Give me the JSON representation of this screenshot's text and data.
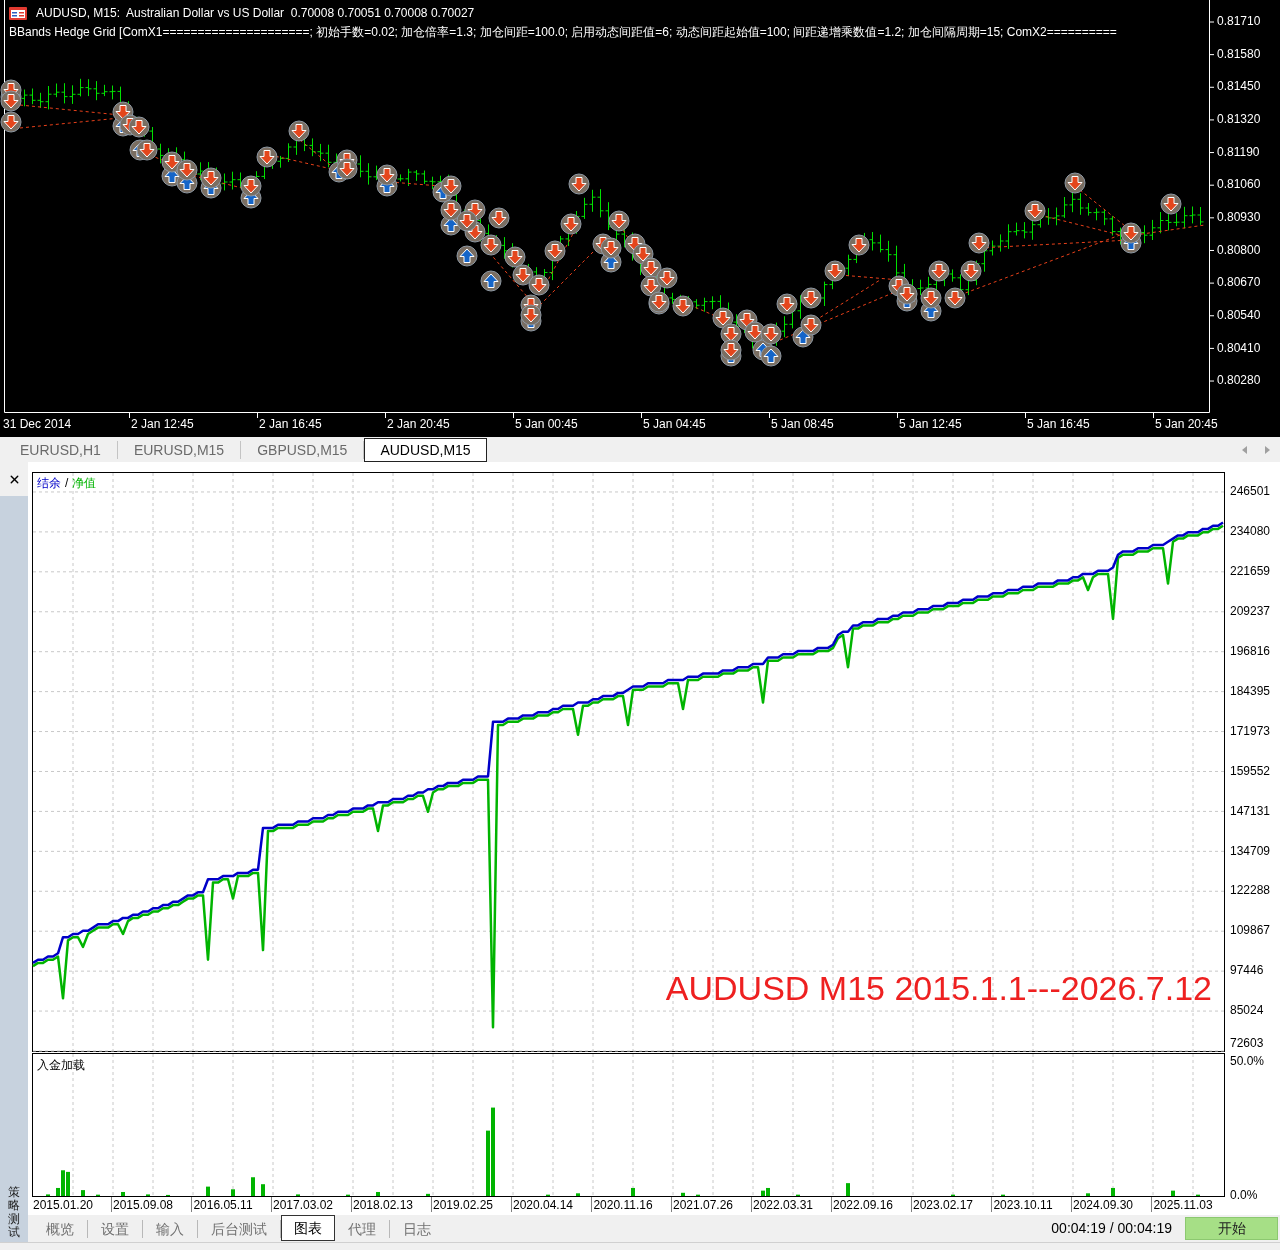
{
  "chart_window": {
    "symbol_line": "AUDUSD, M15:  Australian Dollar vs US Dollar  0.70008 0.70051 0.70008 0.70027",
    "indicator_line": "BBands Hedge Grid [ComX1=====================; 初始手数=0.02; 加仓倍率=1.3; 加仓间距=100.0; 启用动态间距值=6; 动态间距起始值=100; 间距递增乘数值=1.2; 加仓间隔周期=15; ComX2==========",
    "price_labels": [
      "0.81710",
      "0.81580",
      "0.81450",
      "0.81320",
      "0.81190",
      "0.81060",
      "0.80930",
      "0.80800",
      "0.80670",
      "0.80540",
      "0.80410",
      "0.80280"
    ],
    "time_labels": [
      "31 Dec 2014",
      "2 Jan 12:45",
      "2 Jan 16:45",
      "2 Jan 20:45",
      "5 Jan 00:45",
      "5 Jan 04:45",
      "5 Jan 08:45",
      "5 Jan 12:45",
      "5 Jan 16:45",
      "5 Jan 20:45"
    ]
  },
  "chart_tabs": [
    {
      "label": "EURUSD,H1",
      "selected": false
    },
    {
      "label": "EURUSD,M15",
      "selected": false
    },
    {
      "label": "GBPUSD,M15",
      "selected": false
    },
    {
      "label": "AUDUSD,M15",
      "selected": true
    }
  ],
  "tester": {
    "panel_title": "策略测试",
    "equity_chart": {
      "legend_separator": "/",
      "chart_data": {
        "type": "line",
        "grid": true,
        "series": [
          {
            "name": "结余",
            "color": "#0000c8",
            "values": [
              100000,
              101000,
              101000,
              102000,
              102000,
              103000,
              108000,
              108000,
              109000,
              109000,
              110000,
              110000,
              111000,
              112000,
              112000,
              112000,
              113000,
              113000,
              114000,
              114000,
              115000,
              115000,
              116000,
              116000,
              117000,
              117000,
              118000,
              118000,
              119000,
              119000,
              120000,
              121000,
              121000,
              122000,
              122000,
              126000,
              126000,
              126000,
              127000,
              127000,
              127000,
              128000,
              128000,
              128000,
              129000,
              129000,
              142000,
              142000,
              142000,
              143000,
              143000,
              143000,
              143000,
              144000,
              144000,
              144000,
              145000,
              145000,
              145000,
              146000,
              146000,
              147000,
              147000,
              147000,
              148000,
              148000,
              148000,
              149000,
              149000,
              150000,
              150000,
              150000,
              151000,
              151000,
              151000,
              152000,
              152000,
              153000,
              153000,
              154000,
              154000,
              155000,
              155000,
              156000,
              156000,
              156000,
              157000,
              157000,
              157000,
              158000,
              158000,
              158000,
              175000,
              175000,
              175000,
              176000,
              176000,
              176000,
              177000,
              177000,
              177000,
              178000,
              178000,
              178000,
              179000,
              179000,
              180000,
              180000,
              180000,
              181000,
              181000,
              181000,
              182000,
              182000,
              183000,
              183000,
              183000,
              184000,
              184000,
              185000,
              186000,
              186000,
              186000,
              187000,
              187000,
              187000,
              187000,
              188000,
              188000,
              188000,
              188000,
              189000,
              189000,
              189000,
              190000,
              190000,
              190000,
              190000,
              191000,
              191000,
              191000,
              192000,
              192000,
              192000,
              193000,
              193000,
              193000,
              195000,
              195000,
              195000,
              196000,
              196000,
              196000,
              197000,
              197000,
              197000,
              197000,
              198000,
              198000,
              198000,
              199000,
              202000,
              203000,
              203000,
              205000,
              205000,
              206000,
              206000,
              206000,
              207000,
              207000,
              207000,
              208000,
              208000,
              209000,
              209000,
              209000,
              210000,
              210000,
              210000,
              211000,
              211000,
              211000,
              212000,
              212000,
              212000,
              213000,
              213000,
              213000,
              214000,
              214000,
              214000,
              215000,
              215000,
              215000,
              216000,
              216000,
              216000,
              217000,
              217000,
              217000,
              218000,
              218000,
              218000,
              218000,
              219000,
              219000,
              219000,
              220000,
              220000,
              221000,
              221000,
              221000,
              222000,
              222000,
              222000,
              223000,
              227000,
              228000,
              228000,
              228000,
              229000,
              229000,
              229000,
              230000,
              230000,
              230000,
              231000,
              232000,
              233000,
              233000,
              234000,
              234000,
              234000,
              235000,
              235000,
              236000,
              236000,
              237000
            ]
          },
          {
            "name": "净值",
            "color": "#00b400",
            "values": [
              99000,
              100000,
              100000,
              101000,
              101000,
              102000,
              89000,
              107000,
              108000,
              108000,
              105000,
              109000,
              110000,
              111000,
              111000,
              111000,
              112000,
              112000,
              109000,
              113000,
              114000,
              114000,
              115000,
              115000,
              116000,
              116000,
              117000,
              117000,
              118000,
              118000,
              119000,
              120000,
              120000,
              121000,
              121000,
              101000,
              125000,
              125000,
              126000,
              126000,
              120000,
              127000,
              127000,
              127000,
              128000,
              128000,
              104000,
              141000,
              141000,
              142000,
              142000,
              142000,
              142000,
              143000,
              143000,
              143000,
              144000,
              144000,
              144000,
              145000,
              145000,
              146000,
              146000,
              146000,
              147000,
              147000,
              147000,
              148000,
              148000,
              141000,
              149000,
              149000,
              150000,
              150000,
              150000,
              151000,
              151000,
              152000,
              152000,
              147000,
              153000,
              154000,
              154000,
              155000,
              155000,
              155000,
              156000,
              156000,
              156000,
              157000,
              157000,
              157000,
              80000,
              174000,
              174000,
              175000,
              175000,
              175000,
              176000,
              176000,
              176000,
              177000,
              177000,
              177000,
              178000,
              178000,
              179000,
              179000,
              179000,
              171000,
              180000,
              180000,
              181000,
              181000,
              182000,
              182000,
              182000,
              183000,
              183000,
              174000,
              185000,
              185000,
              185000,
              186000,
              186000,
              186000,
              186000,
              187000,
              187000,
              187000,
              179000,
              188000,
              188000,
              188000,
              189000,
              189000,
              189000,
              189000,
              190000,
              190000,
              190000,
              191000,
              191000,
              191000,
              192000,
              192000,
              181000,
              194000,
              194000,
              194000,
              195000,
              195000,
              195000,
              196000,
              196000,
              196000,
              196000,
              197000,
              197000,
              197000,
              198000,
              201000,
              202000,
              192000,
              204000,
              204000,
              205000,
              205000,
              205000,
              206000,
              206000,
              206000,
              207000,
              207000,
              208000,
              208000,
              208000,
              209000,
              209000,
              209000,
              210000,
              210000,
              210000,
              211000,
              211000,
              211000,
              212000,
              212000,
              212000,
              213000,
              213000,
              213000,
              214000,
              214000,
              214000,
              215000,
              215000,
              215000,
              216000,
              216000,
              216000,
              217000,
              217000,
              217000,
              217000,
              218000,
              218000,
              218000,
              219000,
              219000,
              220000,
              216000,
              220000,
              221000,
              221000,
              221000,
              207000,
              226000,
              227000,
              227000,
              227000,
              228000,
              228000,
              228000,
              229000,
              229000,
              229000,
              218000,
              231000,
              232000,
              232000,
              233000,
              233000,
              233000,
              234000,
              234000,
              235000,
              235000,
              236000
            ]
          }
        ],
        "ylim": [
          72603,
          252400
        ],
        "yticks": [
          246501,
          234080,
          221659,
          209237,
          196816,
          184395,
          171973,
          159552,
          147131,
          134709,
          122288,
          109867,
          97446,
          85024,
          72603
        ],
        "annotations": [
          {
            "text": "AUDUSD M15 2015.1.1---2026.7.12"
          }
        ]
      }
    },
    "deposit_chart": {
      "chart_data": {
        "type": "bar",
        "grid": true,
        "title": "入金加载",
        "categories": [
          null,
          null,
          null,
          null,
          null,
          null,
          "2015.01.20",
          null,
          null,
          null,
          null,
          null,
          null,
          null,
          null,
          null,
          null,
          null,
          null,
          null,
          null,
          null,
          "2015.09.08",
          null,
          null,
          null,
          null,
          null,
          null,
          null,
          null,
          null,
          null,
          null,
          null,
          null,
          null,
          null,
          "2016.05.11",
          null,
          null,
          null,
          null,
          null,
          null,
          null,
          null,
          null,
          null,
          null,
          null,
          null,
          null,
          null,
          "2017.03.02",
          null,
          null,
          null,
          null,
          null,
          null,
          null,
          null,
          null,
          null,
          null,
          null,
          null,
          null,
          null,
          "2018.02.13",
          null,
          null,
          null,
          null,
          null,
          null,
          null,
          null,
          null,
          null,
          null,
          null,
          null,
          null,
          null,
          "2019.02.25",
          null,
          null,
          null,
          null,
          null,
          null,
          null,
          null,
          null,
          null,
          null,
          null,
          null,
          null,
          null,
          "2020.04.14",
          null,
          null,
          null,
          null,
          null,
          null,
          null,
          null,
          null,
          null,
          null,
          null,
          null,
          null,
          null,
          "2020.11.16",
          null,
          null,
          null,
          null,
          null,
          null,
          null,
          null,
          null,
          null,
          null,
          null,
          null,
          null,
          null,
          "2021.07.26",
          null,
          null,
          null,
          null,
          null,
          null,
          null,
          null,
          null,
          null,
          null,
          null,
          null,
          null,
          null,
          "2022.03.31",
          null,
          null,
          null,
          null,
          null,
          null,
          null,
          null,
          null,
          null,
          null,
          null,
          null,
          null,
          null,
          "2022.09.16",
          null,
          null,
          null,
          null,
          null,
          null,
          null,
          null,
          null,
          null,
          null,
          null,
          null,
          null,
          null,
          "2023.02.17",
          null,
          null,
          null,
          null,
          null,
          null,
          null,
          null,
          null,
          null,
          null,
          null,
          null,
          null,
          null,
          "2023.10.11",
          null,
          null,
          null,
          null,
          null,
          null,
          null,
          null,
          null,
          null,
          null,
          null,
          null,
          null,
          null,
          "2024.09.30",
          null,
          null,
          null,
          null,
          null,
          null,
          null,
          null,
          null,
          null,
          null,
          null,
          null,
          null,
          null,
          "2025.11.03",
          null,
          null,
          null,
          null,
          null,
          null,
          null,
          null
        ],
        "values": [
          null,
          null,
          null,
          0.6,
          null,
          3,
          9.6,
          9,
          null,
          null,
          2.2,
          null,
          null,
          0.5,
          null,
          null,
          null,
          null,
          1.5,
          null,
          null,
          null,
          null,
          0.6,
          null,
          null,
          null,
          0.4,
          null,
          null,
          null,
          null,
          null,
          null,
          null,
          3.5,
          null,
          null,
          null,
          null,
          2.5,
          null,
          null,
          null,
          7,
          null,
          4.4,
          null,
          null,
          null,
          null,
          null,
          null,
          0.6,
          null,
          null,
          null,
          null,
          null,
          null,
          null,
          null,
          null,
          0.5,
          null,
          null,
          null,
          null,
          null,
          1.5,
          null,
          null,
          null,
          null,
          null,
          null,
          null,
          null,
          null,
          0.8,
          null,
          null,
          null,
          null,
          null,
          null,
          null,
          null,
          null,
          null,
          null,
          24.4,
          33,
          null,
          null,
          null,
          null,
          null,
          null,
          null,
          null,
          null,
          null,
          0.5,
          null,
          null,
          null,
          null,
          null,
          1,
          null,
          null,
          null,
          null,
          null,
          null,
          null,
          null,
          null,
          null,
          3,
          null,
          null,
          null,
          null,
          null,
          null,
          null,
          null,
          null,
          1.2,
          null,
          null,
          0.5,
          null,
          null,
          null,
          null,
          null,
          null,
          null,
          null,
          null,
          null,
          null,
          null,
          2,
          3,
          null,
          null,
          null,
          null,
          null,
          0.5,
          null,
          null,
          null,
          null,
          null,
          null,
          null,
          null,
          null,
          4.8,
          null,
          null,
          null,
          null,
          null,
          null,
          null,
          null,
          null,
          null,
          null,
          null,
          null,
          null,
          null,
          null,
          null,
          null,
          null,
          null,
          0.5,
          null,
          null,
          null,
          null,
          null,
          null,
          null,
          null,
          null,
          0.5,
          null,
          null,
          null,
          null,
          null,
          null,
          null,
          null,
          null,
          null,
          null,
          null,
          null,
          null,
          null,
          null,
          1,
          null,
          null,
          null,
          null,
          3,
          null,
          null,
          null,
          null,
          null,
          null,
          null,
          null,
          null,
          null,
          null,
          2,
          null,
          null,
          null,
          null,
          0.5,
          null,
          null,
          null,
          null,
          null
        ],
        "ylim": [
          0,
          53
        ],
        "yticks": [
          {
            "value": 50,
            "label": "50.0%"
          },
          {
            "value": 0,
            "label": "0.0%"
          }
        ]
      }
    },
    "tabs": [
      {
        "label": "概览",
        "selected": false
      },
      {
        "label": "设置",
        "selected": false
      },
      {
        "label": "输入",
        "selected": false
      },
      {
        "label": "后台测试",
        "selected": false
      },
      {
        "label": "图表",
        "selected": true
      },
      {
        "label": "代理",
        "selected": false
      },
      {
        "label": "日志",
        "selected": false
      }
    ],
    "elapsed": "00:04:19 / 00:04:19",
    "start_button": "开始"
  }
}
